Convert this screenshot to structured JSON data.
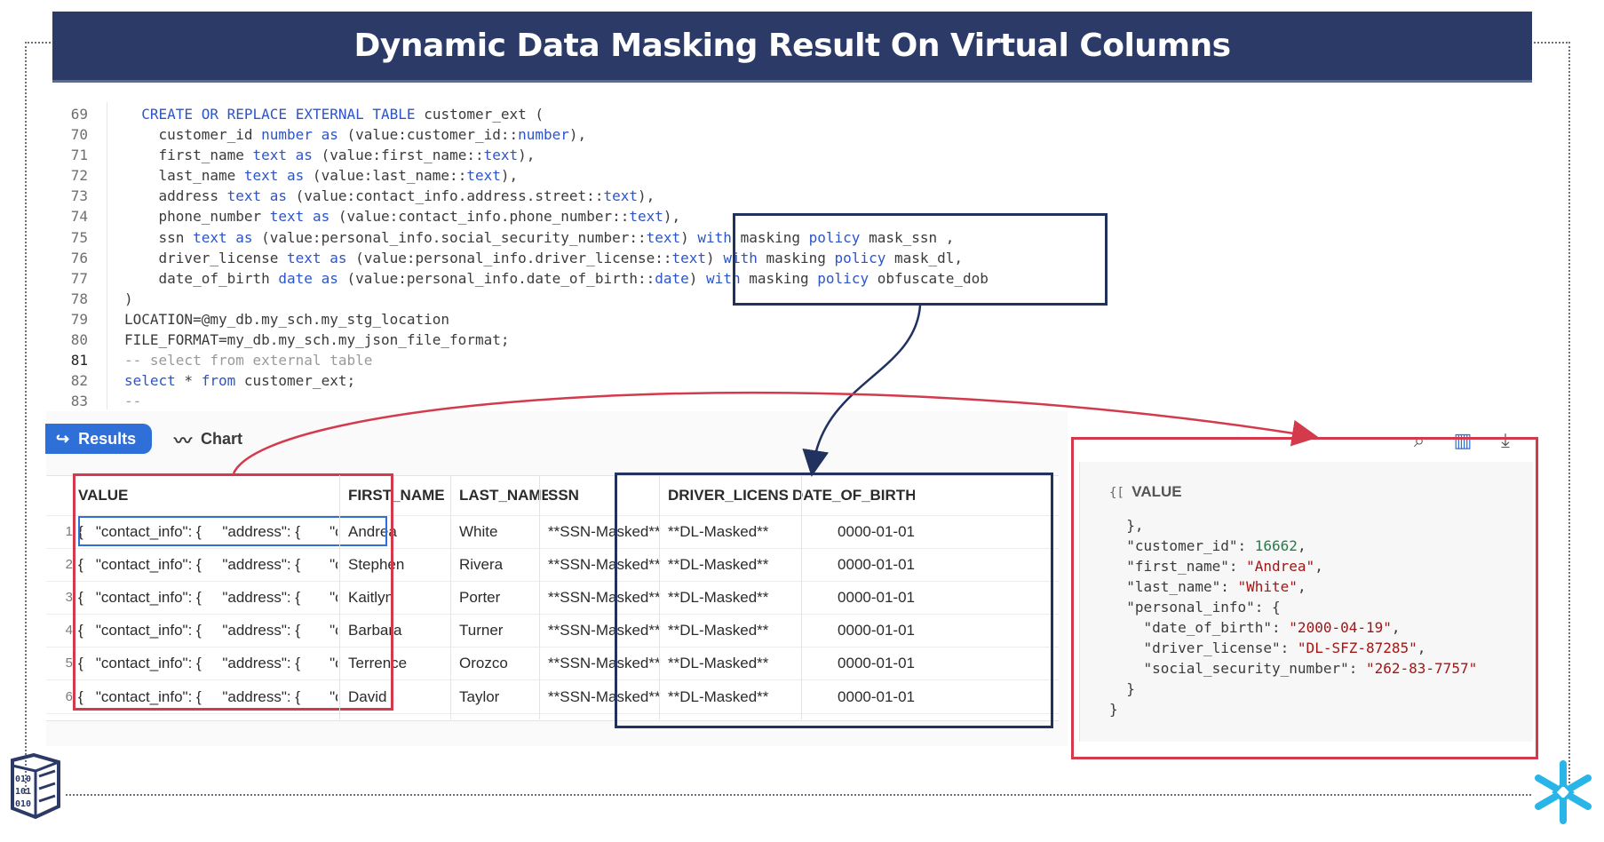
{
  "title": "Dynamic Data Masking Result On Virtual Columns",
  "colors": {
    "banner": "#2b3a67",
    "keyword": "#2c55c9",
    "highlight_red": "#d33a4b",
    "highlight_navy": "#22325e",
    "accent": "#2f6fd8"
  },
  "code": {
    "lines": [
      {
        "n": "69",
        "t": "  CREATE OR REPLACE EXTERNAL TABLE customer_ext ("
      },
      {
        "n": "70",
        "t": "    customer_id number as (value:customer_id::number),"
      },
      {
        "n": "71",
        "t": "    first_name text as (value:first_name::text),"
      },
      {
        "n": "72",
        "t": "    last_name text as (value:last_name::text),"
      },
      {
        "n": "73",
        "t": "    address text as (value:contact_info.address.street::text),"
      },
      {
        "n": "74",
        "t": "    phone_number text as (value:contact_info.phone_number::text),"
      },
      {
        "n": "75",
        "t": "    ssn text as (value:personal_info.social_security_number::text) with masking policy mask_ssn ,"
      },
      {
        "n": "76",
        "t": "    driver_license text as (value:personal_info.driver_license::text) with masking policy mask_dl,"
      },
      {
        "n": "77",
        "t": "    date_of_birth date as (value:personal_info.date_of_birth::date) with masking policy obfuscate_dob"
      },
      {
        "n": "78",
        "t": ")"
      },
      {
        "n": "79",
        "t": "LOCATION=@my_db.my_sch.my_stg_location"
      },
      {
        "n": "80",
        "t": "FILE_FORMAT=my_db.my_sch.my_json_file_format;"
      },
      {
        "n": "81",
        "t": "-- select from external table"
      },
      {
        "n": "82",
        "t": "select * from customer_ext;"
      },
      {
        "n": "83",
        "t": "--"
      }
    ]
  },
  "toolbar": {
    "results_label": "Results",
    "chart_label": "Chart"
  },
  "grid": {
    "columns": [
      "VALUE",
      "FIRST_NAME",
      "LAST_NAME",
      "SSN",
      "DRIVER_LICENSE",
      "DATE_OF_BIRTH"
    ],
    "rows": [
      {
        "n": "1",
        "value": "{   \"contact_info\": {     \"address\": {       \"city\"",
        "first": "Andrea",
        "last": "White",
        "ssn": "**SSN-Masked**",
        "dl": "**DL-Masked**",
        "dob": "0000-01-01"
      },
      {
        "n": "2",
        "value": "{   \"contact_info\": {     \"address\": {       \"city\"",
        "first": "Stephen",
        "last": "Rivera",
        "ssn": "**SSN-Masked**",
        "dl": "**DL-Masked**",
        "dob": "0000-01-01"
      },
      {
        "n": "3",
        "value": "{   \"contact_info\": {     \"address\": {       \"city\"",
        "first": "Kaitlyn",
        "last": "Porter",
        "ssn": "**SSN-Masked**",
        "dl": "**DL-Masked**",
        "dob": "0000-01-01"
      },
      {
        "n": "4",
        "value": "{   \"contact_info\": {     \"address\": {       \"city\"",
        "first": "Barbara",
        "last": "Turner",
        "ssn": "**SSN-Masked**",
        "dl": "**DL-Masked**",
        "dob": "0000-01-01"
      },
      {
        "n": "5",
        "value": "{   \"contact_info\": {     \"address\": {       \"city\"",
        "first": "Terrence",
        "last": "Orozco",
        "ssn": "**SSN-Masked**",
        "dl": "**DL-Masked**",
        "dob": "0000-01-01"
      },
      {
        "n": "6",
        "value": "{   \"contact_info\": {     \"address\": {       \"city\"",
        "first": "David",
        "last": "Taylor",
        "ssn": "**SSN-Masked**",
        "dl": "**DL-Masked**",
        "dob": "0000-01-01"
      }
    ]
  },
  "detail": {
    "header": "VALUE",
    "lines": [
      {
        "t": "  },",
        "kind": "plain"
      },
      {
        "k": "  \"customer_id\": ",
        "v": "16662",
        "s": ",",
        "kind": "num"
      },
      {
        "k": "  \"first_name\": ",
        "v": "\"Andrea\"",
        "s": ",",
        "kind": "str"
      },
      {
        "k": "  \"last_name\": ",
        "v": "\"White\"",
        "s": ",",
        "kind": "str"
      },
      {
        "t": "  \"personal_info\": {",
        "kind": "plain"
      },
      {
        "k": "    \"date_of_birth\": ",
        "v": "\"2000-04-19\"",
        "s": ",",
        "kind": "str"
      },
      {
        "k": "    \"driver_license\": ",
        "v": "\"DL-SFZ-87285\"",
        "s": ",",
        "kind": "str"
      },
      {
        "k": "    \"social_security_number\": ",
        "v": "\"262-83-7757\"",
        "s": "",
        "kind": "str"
      },
      {
        "t": "  }",
        "kind": "plain"
      },
      {
        "t": "}",
        "kind": "plain"
      }
    ]
  }
}
